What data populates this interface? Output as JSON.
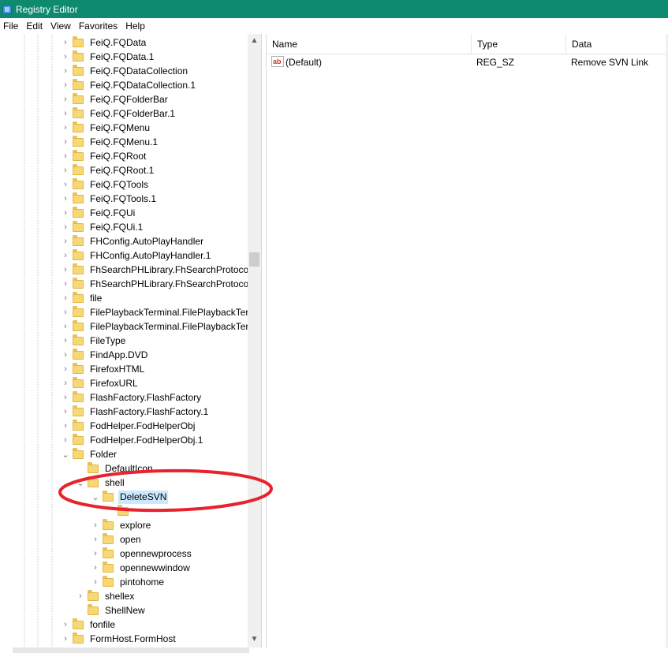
{
  "window": {
    "title": "Registry Editor",
    "icon": "registry-editor-icon"
  },
  "menu": [
    "File",
    "Edit",
    "View",
    "Favorites",
    "Help"
  ],
  "tree": [
    {
      "label": "FeiQ.FQData",
      "chevron": "›",
      "level": 0
    },
    {
      "label": "FeiQ.FQData.1",
      "chevron": "›",
      "level": 0
    },
    {
      "label": "FeiQ.FQDataCollection",
      "chevron": "›",
      "level": 0
    },
    {
      "label": "FeiQ.FQDataCollection.1",
      "chevron": "›",
      "level": 0
    },
    {
      "label": "FeiQ.FQFolderBar",
      "chevron": "›",
      "level": 0
    },
    {
      "label": "FeiQ.FQFolderBar.1",
      "chevron": "›",
      "level": 0
    },
    {
      "label": "FeiQ.FQMenu",
      "chevron": "›",
      "level": 0
    },
    {
      "label": "FeiQ.FQMenu.1",
      "chevron": "›",
      "level": 0
    },
    {
      "label": "FeiQ.FQRoot",
      "chevron": "›",
      "level": 0
    },
    {
      "label": "FeiQ.FQRoot.1",
      "chevron": "›",
      "level": 0
    },
    {
      "label": "FeiQ.FQTools",
      "chevron": "›",
      "level": 0
    },
    {
      "label": "FeiQ.FQTools.1",
      "chevron": "›",
      "level": 0
    },
    {
      "label": "FeiQ.FQUi",
      "chevron": "›",
      "level": 0
    },
    {
      "label": "FeiQ.FQUi.1",
      "chevron": "›",
      "level": 0
    },
    {
      "label": "FHConfig.AutoPlayHandler",
      "chevron": "›",
      "level": 0
    },
    {
      "label": "FHConfig.AutoPlayHandler.1",
      "chevron": "›",
      "level": 0
    },
    {
      "label": "FhSearchPHLibrary.FhSearchProtocol",
      "chevron": "›",
      "level": 0
    },
    {
      "label": "FhSearchPHLibrary.FhSearchProtocol",
      "chevron": "›",
      "level": 0
    },
    {
      "label": "file",
      "chevron": "›",
      "level": 0
    },
    {
      "label": "FilePlaybackTerminal.FilePlaybackTerm",
      "chevron": "›",
      "level": 0
    },
    {
      "label": "FilePlaybackTerminal.FilePlaybackTerm",
      "chevron": "›",
      "level": 0
    },
    {
      "label": "FileType",
      "chevron": "›",
      "level": 0
    },
    {
      "label": "FindApp.DVD",
      "chevron": "›",
      "level": 0
    },
    {
      "label": "FirefoxHTML",
      "chevron": "›",
      "level": 0
    },
    {
      "label": "FirefoxURL",
      "chevron": "›",
      "level": 0
    },
    {
      "label": "FlashFactory.FlashFactory",
      "chevron": "›",
      "level": 0
    },
    {
      "label": "FlashFactory.FlashFactory.1",
      "chevron": "›",
      "level": 0
    },
    {
      "label": "FodHelper.FodHelperObj",
      "chevron": "›",
      "level": 0
    },
    {
      "label": "FodHelper.FodHelperObj.1",
      "chevron": "›",
      "level": 0
    },
    {
      "label": "Folder",
      "chevron": "⌄",
      "level": 0
    },
    {
      "label": "DefaultIcon",
      "chevron": "",
      "level": 1
    },
    {
      "label": "shell",
      "chevron": "⌄",
      "level": 1
    },
    {
      "label": "DeleteSVN",
      "chevron": "⌄",
      "level": 2,
      "selected": true
    },
    {
      "label": "",
      "chevron": "",
      "level": 3
    },
    {
      "label": "explore",
      "chevron": "›",
      "level": 2
    },
    {
      "label": "open",
      "chevron": "›",
      "level": 2
    },
    {
      "label": "opennewprocess",
      "chevron": "›",
      "level": 2
    },
    {
      "label": "opennewwindow",
      "chevron": "›",
      "level": 2
    },
    {
      "label": "pintohome",
      "chevron": "›",
      "level": 2
    },
    {
      "label": "shellex",
      "chevron": "›",
      "level": 1
    },
    {
      "label": "ShellNew",
      "chevron": "",
      "level": 1
    },
    {
      "label": "fonfile",
      "chevron": "›",
      "level": 0
    },
    {
      "label": "FormHost.FormHost",
      "chevron": "›",
      "level": 0
    }
  ],
  "scrollbar": {
    "up": "▲",
    "down": "▼"
  },
  "list": {
    "columns": [
      "Name",
      "Type",
      "Data"
    ],
    "rows": [
      {
        "icon": "string-value-icon",
        "icon_text": "ab",
        "name": "(Default)",
        "type": "REG_SZ",
        "data": "Remove SVN Link"
      }
    ]
  },
  "annotation": {
    "shape": "red-ellipse-highlight",
    "color": "#e8232d",
    "target": "DeleteSVN"
  }
}
